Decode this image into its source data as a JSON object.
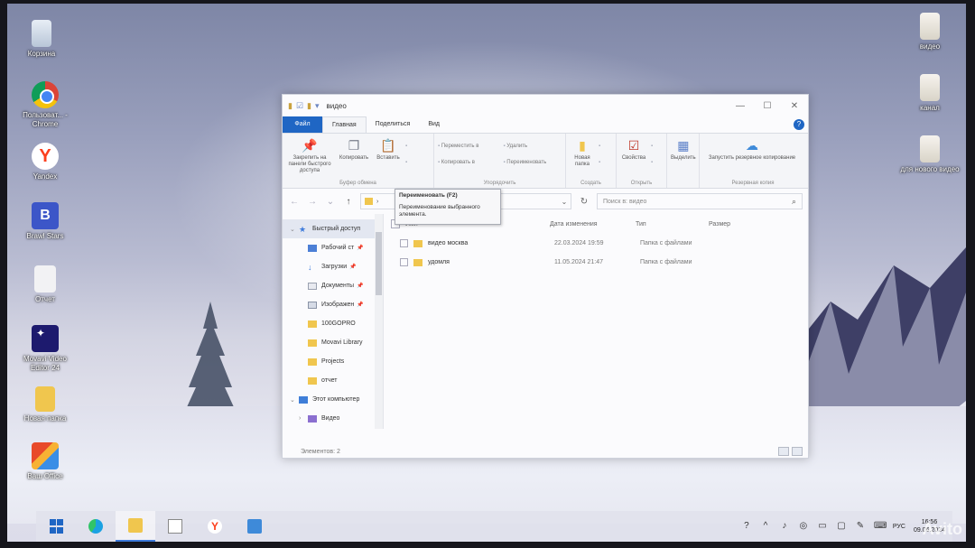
{
  "desktop": {
    "left_icons": [
      {
        "name": "recycle-bin",
        "label": "Корзина",
        "icon": "recycle-bin-icon"
      },
      {
        "name": "chrome-shortcut",
        "label": "Пользоват... - Chrome",
        "icon": "chrome-icon"
      },
      {
        "name": "yandex-shortcut",
        "label": "Yandex",
        "icon": "yandex-icon"
      },
      {
        "name": "brawl-stars-shortcut",
        "label": "Brawl Stars",
        "icon": "brawl-stars-icon"
      },
      {
        "name": "document-shortcut",
        "label": "Отчет",
        "icon": "document-icon"
      },
      {
        "name": "movavi-shortcut",
        "label": "Movavi Video Editor 24",
        "icon": "movavi-icon"
      },
      {
        "name": "new-folder-shortcut",
        "label": "Новая папка",
        "icon": "folder-icon"
      },
      {
        "name": "office-shortcut",
        "label": "Ваш Office",
        "icon": "office-icon"
      }
    ],
    "right_icons": [
      {
        "name": "video-file",
        "label": "видео",
        "icon": "file-icon"
      },
      {
        "name": "channel-file",
        "label": "канал",
        "icon": "file-icon"
      },
      {
        "name": "new-video-file",
        "label": "для нового видео",
        "icon": "file-icon"
      }
    ]
  },
  "explorer": {
    "title": "видео",
    "tabs": [
      "Файл",
      "Главная",
      "Поделиться",
      "Вид"
    ],
    "ribbon": {
      "clipboard": {
        "caption": "Буфер обмена",
        "pin": "Закрепить на панели быстрого доступа",
        "copy": "Копировать",
        "paste": "Вставить"
      },
      "organize": {
        "caption": "Упорядочить",
        "move_to": "Переместить в",
        "copy_to": "Копировать в",
        "delete": "Удалить",
        "rename": "Переименовать"
      },
      "create": {
        "caption": "Создать",
        "new_folder": "Новая папка"
      },
      "open": {
        "caption": "Открыть",
        "properties": "Свойства"
      },
      "select": {
        "select": "Выделить"
      },
      "backup": {
        "caption": "Резервная копия",
        "start_backup": "Запустить резервное копирование"
      }
    },
    "tooltip": {
      "title": "Переименовать (F2)",
      "body": "Переименование выбранного элемента."
    },
    "search_placeholder": "Поиск в: видео",
    "nav": {
      "quick_access": "Быстрый доступ",
      "items": [
        {
          "label": "Рабочий ст",
          "icon": "desk",
          "pinned": true
        },
        {
          "label": "Загрузки",
          "icon": "dl",
          "pinned": true
        },
        {
          "label": "Документы",
          "icon": "docs",
          "pinned": true
        },
        {
          "label": "Изображен",
          "icon": "pics",
          "pinned": true
        },
        {
          "label": "100GOPRO",
          "icon": "fold",
          "pinned": false
        },
        {
          "label": "Movavi Library",
          "icon": "fold",
          "pinned": false
        },
        {
          "label": "Projects",
          "icon": "fold",
          "pinned": false
        },
        {
          "label": "отчет",
          "icon": "fold",
          "pinned": false
        }
      ],
      "this_pc": "Этот компьютер",
      "video": "Видео"
    },
    "columns": {
      "name": "Имя",
      "date": "Дата изменения",
      "type": "Тип",
      "size": "Размер"
    },
    "files": [
      {
        "name": "видео москва",
        "date": "22.03.2024 19:59",
        "type": "Папка с файлами"
      },
      {
        "name": "удомля",
        "date": "11.05.2024 21:47",
        "type": "Папка с файлами"
      }
    ],
    "status": "Элементов: 2"
  },
  "taskbar": {
    "apps": [
      "start",
      "edge",
      "explorer",
      "store",
      "yandex",
      "mail"
    ],
    "language": "РУС",
    "time": "16:56",
    "date": "09.06.2024"
  },
  "watermark": "Avito"
}
